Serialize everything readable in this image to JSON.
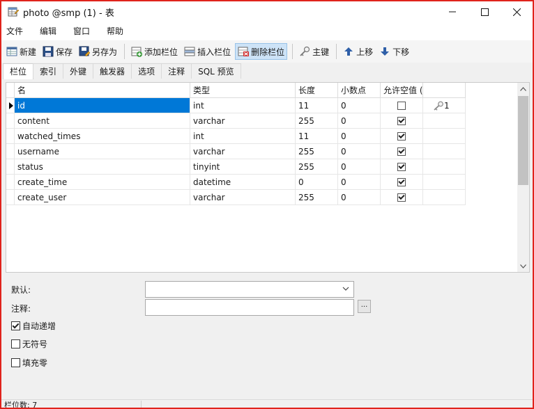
{
  "window": {
    "title": "photo @smp (1) - 表",
    "controls": [
      "minimize",
      "maximize",
      "close"
    ]
  },
  "menu": [
    "文件",
    "编辑",
    "窗口",
    "帮助"
  ],
  "toolbar": {
    "new": "新建",
    "save": "保存",
    "save_as": "另存为",
    "add_field": "添加栏位",
    "insert_field": "插入栏位",
    "delete_field": "删除栏位",
    "primary_key": "主键",
    "move_up": "上移",
    "move_down": "下移"
  },
  "tabs": [
    "栏位",
    "索引",
    "外键",
    "触发器",
    "选项",
    "注释",
    "SQL 预览"
  ],
  "active_tab": "栏位",
  "grid": {
    "headers": {
      "name": "名",
      "type": "类型",
      "length": "长度",
      "decimals": "小数点",
      "allow_null": "允许空值 (",
      "key": ""
    },
    "rows": [
      {
        "name": "id",
        "type": "int",
        "length": "11",
        "decimals": "0",
        "allow_null": false,
        "key": "1",
        "selected": true
      },
      {
        "name": "content",
        "type": "varchar",
        "length": "255",
        "decimals": "0",
        "allow_null": true,
        "key": ""
      },
      {
        "name": "watched_times",
        "type": "int",
        "length": "11",
        "decimals": "0",
        "allow_null": true,
        "key": ""
      },
      {
        "name": "username",
        "type": "varchar",
        "length": "255",
        "decimals": "0",
        "allow_null": true,
        "key": ""
      },
      {
        "name": "status",
        "type": "tinyint",
        "length": "255",
        "decimals": "0",
        "allow_null": true,
        "key": ""
      },
      {
        "name": "create_time",
        "type": "datetime",
        "length": "0",
        "decimals": "0",
        "allow_null": true,
        "key": ""
      },
      {
        "name": "create_user",
        "type": "varchar",
        "length": "255",
        "decimals": "0",
        "allow_null": true,
        "key": ""
      }
    ]
  },
  "properties": {
    "default_label": "默认:",
    "default_value": "",
    "comment_label": "注释:",
    "comment_value": "",
    "comment_button": "...",
    "auto_increment_label": "自动递增",
    "auto_increment": true,
    "unsigned_label": "无符号",
    "unsigned": false,
    "zerofill_label": "填充零",
    "zerofill": false
  },
  "status": {
    "field_count": "栏位数: 7"
  },
  "colors": {
    "frame_border": "#e0231c",
    "selection": "#0078d7"
  }
}
